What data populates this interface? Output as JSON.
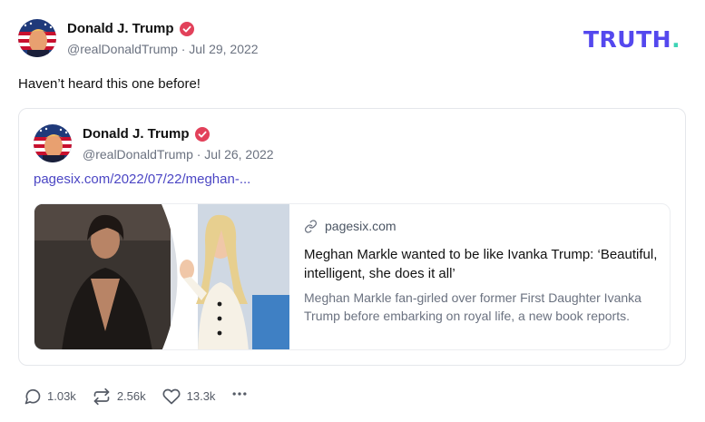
{
  "brand": {
    "logo_text": "TRUTH",
    "logo_dot": ".",
    "color_primary": "#5448ee",
    "color_dot": "#3ed4b6"
  },
  "post": {
    "author_name": "Donald J. Trump",
    "meta": "@realDonaldTrump · Jul 29, 2022",
    "verified_icon": "verified-badge-icon",
    "text": "Haven’t heard this one before!"
  },
  "quoted_post": {
    "author_name": "Donald J. Trump",
    "meta": "@realDonaldTrump · Jul 26, 2022",
    "link": "pagesix.com/2022/07/22/meghan-...",
    "link_color": "#4b46c4",
    "preview": {
      "domain": "pagesix.com",
      "domain_icon": "link-icon",
      "title": "Meghan Markle wanted to be like Ivanka Trump: ‘Beautiful, intelligent, she does it all’",
      "description": "Meghan Markle fan-girled over former First Daughter Ivanka Trump before embarking on royal life, a new book reports."
    }
  },
  "actions": {
    "replies": "1.03k",
    "retruths": "2.56k",
    "likes": "13.3k",
    "icons": [
      "reply-icon",
      "retruth-icon",
      "like-icon",
      "more-icon"
    ]
  }
}
